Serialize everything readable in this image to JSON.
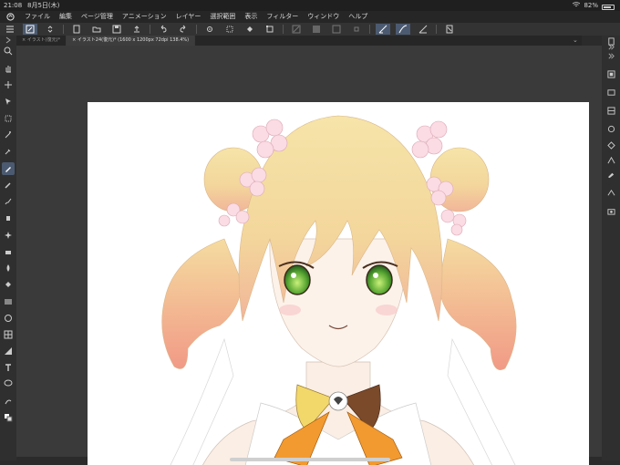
{
  "status": {
    "time": "21:08",
    "date": "8月5日(木)",
    "battery": "82%",
    "battery_level": 0.82
  },
  "menu": [
    "ファイル",
    "編集",
    "ページ管理",
    "アニメーション",
    "レイヤー",
    "選択範囲",
    "表示",
    "フィルター",
    "ウィンドウ",
    "ヘルプ"
  ],
  "tabs": [
    {
      "label": "イラスト(復元)*"
    },
    {
      "label": "イラスト24(復元)* (1600 x 1200px 72dpi 138.4%)"
    }
  ],
  "colors": {
    "accent": "#4b5a70",
    "bg": "#2b2b2b",
    "canvas": "#ffffff"
  },
  "left_tools": [
    "zoom-icon",
    "hand-icon",
    "move-icon",
    "operation-icon",
    "selection-icon",
    "wand-icon",
    "eyedropper-icon",
    "pen-icon",
    "pencil-icon",
    "brush-icon",
    "airbrush-icon",
    "decoration-icon",
    "eraser-icon",
    "blend-icon",
    "fill-icon",
    "gradient-icon",
    "figure-icon",
    "frame-icon",
    "ruler-icon",
    "text-icon",
    "balloon-icon",
    "correction-icon",
    "color-swatch-icon"
  ],
  "right_tools": [
    "layer-icon",
    "property-icon",
    "navigator-icon",
    "material-icon",
    "color-wheel-icon",
    "sub-tool-icon",
    "tool-property-icon",
    "history-icon",
    "camera-icon",
    "info-icon"
  ]
}
